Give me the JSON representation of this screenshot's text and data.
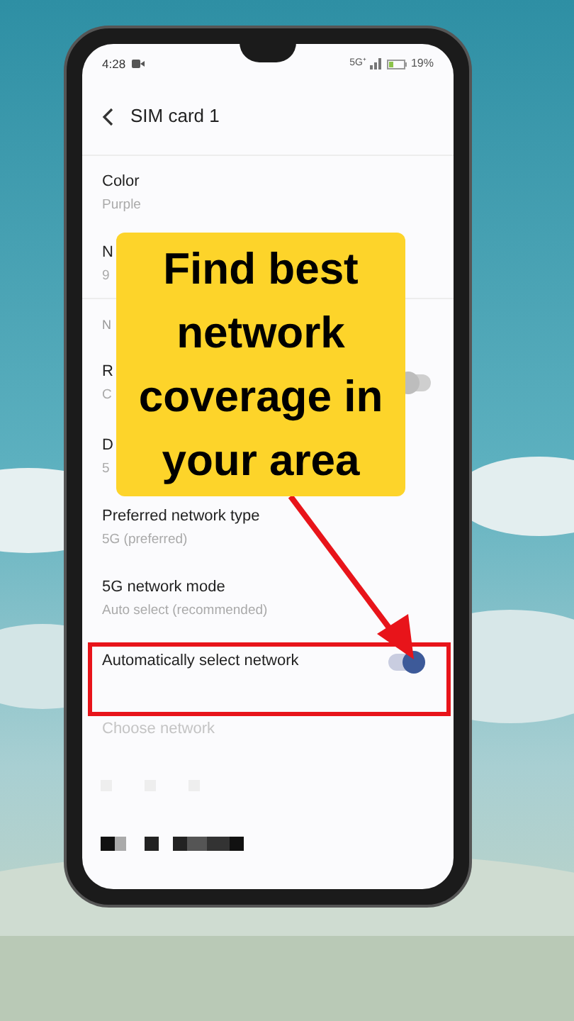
{
  "status_bar": {
    "time": "4:28",
    "network": "5G⁺",
    "battery": "19%"
  },
  "header": {
    "title": "SIM card 1"
  },
  "rows": [
    {
      "kind": "item",
      "title": "Color",
      "subtitle": "Purple"
    },
    {
      "kind": "item",
      "title": "N",
      "subtitle": "9"
    },
    {
      "kind": "section",
      "title": "N"
    },
    {
      "kind": "switch",
      "title": "R",
      "subtitle": "C",
      "on": false
    },
    {
      "kind": "item",
      "title": "D",
      "subtitle": "5"
    },
    {
      "kind": "item",
      "title": "Preferred network type",
      "subtitle": "5G (preferred)"
    },
    {
      "kind": "item",
      "title": "5G network mode",
      "subtitle": "Auto select (recommended)"
    },
    {
      "kind": "switch",
      "title": "Automatically select network",
      "on": true,
      "highlighted": true
    },
    {
      "kind": "item",
      "title": "Choose network",
      "disabled": true
    }
  ],
  "overlay": {
    "caption": "Find best network coverage in your area"
  }
}
